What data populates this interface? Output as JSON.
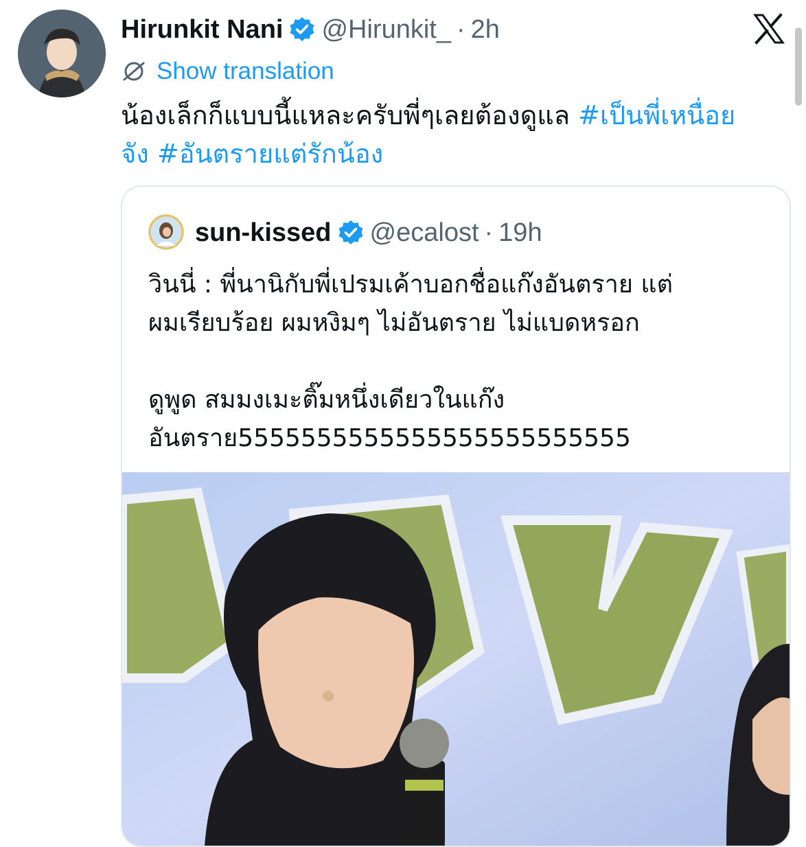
{
  "post": {
    "author": {
      "name": "Hirunkit Nani",
      "handle": "@Hirunkit_",
      "separator": "·",
      "time": "2h"
    },
    "translation_label": "Show translation",
    "text": "น้องเล็กก็แบบนี้แหละครับพี่ๆเลยต้องดูแล",
    "hashtags": [
      "#เป็นพี่เหนื่อยจัง",
      "#อันตรายแต่รักน้อง"
    ]
  },
  "quoted": {
    "author": {
      "name": "sun-kissed",
      "handle": "@ecalost",
      "separator": "·",
      "time": "19h"
    },
    "lines": [
      "วินนี่ : พี่นานิกับพี่เปรมเค้าบอกชื่อแก๊งอันตราย แต่",
      "ผมเรียบร้อย ผมหงิมๆ ไม่อันตราย ไม่แบดหรอก",
      "ดูพูด สมมงเมะติ๊มหนึ่งเดียวในแก๊ง",
      "อันตราย5555555555555555555555555"
    ]
  },
  "icons": {
    "verified": "verified-badge-icon",
    "x_logo": "x-logo-icon",
    "translate": "globe-slash-icon"
  },
  "colors": {
    "link": "#1d9bf0",
    "secondary_text": "#536471",
    "verified": "#1d9bf0"
  }
}
